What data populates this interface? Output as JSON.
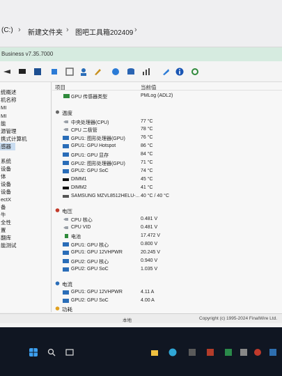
{
  "breadcrumb": {
    "drive": "(C:)",
    "folder1": "新建文件夹",
    "folder2": "图吧工具箱202409"
  },
  "app": {
    "title": "Business v7.35.7000"
  },
  "sidebar": {
    "items": [
      "统概述",
      "机名称",
      "MI",
      "MI",
      "能",
      "源管理",
      "携式计算机",
      "感器",
      "",
      "系统",
      "设备",
      "体",
      "设备",
      "设备",
      "ectX",
      "备",
      "牛",
      "全性",
      "置",
      "翻库",
      "能测试"
    ],
    "selected_index": 7
  },
  "columns": {
    "item": "项目",
    "value": "当前值"
  },
  "sensor_type": {
    "label": "GPU 传感器类型",
    "value": "PMLog (ADL2)"
  },
  "temperature": {
    "title": "温度",
    "rows": [
      {
        "label": "中央处理器(CPU)",
        "value": "77 °C"
      },
      {
        "label": "CPU 二极管",
        "value": "78 °C"
      },
      {
        "label": "GPU1: 图形处理器(GPU)",
        "value": "76 °C"
      },
      {
        "label": "GPU1: GPU Hotspot",
        "value": "86 °C"
      },
      {
        "label": "GPU1: GPU 显存",
        "value": "84 °C"
      },
      {
        "label": "GPU2: 图形处理器(GPU)",
        "value": "71 °C"
      },
      {
        "label": "GPU2: GPU SoC",
        "value": "74 °C"
      },
      {
        "label": "DIMM1",
        "value": "45 °C"
      },
      {
        "label": "DIMM2",
        "value": "41 °C"
      },
      {
        "label": "SAMSUNG MZVL8512HELU-...",
        "value": "40 °C / 40 °C"
      }
    ]
  },
  "voltage": {
    "title": "电压",
    "rows": [
      {
        "label": "CPU 核心",
        "value": "0.481 V"
      },
      {
        "label": "CPU VID",
        "value": "0.481 V"
      },
      {
        "label": "电池",
        "value": "17.472 V"
      },
      {
        "label": "GPU1: GPU 核心",
        "value": "0.800 V"
      },
      {
        "label": "GPU1: GPU 12VHPWR",
        "value": "20.245 V"
      },
      {
        "label": "GPU2: GPU 核心",
        "value": "0.940 V"
      },
      {
        "label": "GPU2: GPU SoC",
        "value": "1.035 V"
      }
    ]
  },
  "current": {
    "title": "电流",
    "rows": [
      {
        "label": "GPU1: GPU 12VHPWR",
        "value": "4.11 A"
      },
      {
        "label": "GPU2: GPU SoC",
        "value": "4.00 A"
      }
    ]
  },
  "power": {
    "title": "功耗"
  },
  "status": {
    "local": "本地",
    "copyright": "Copyright (c) 1995-2024 FinalWire Ltd."
  },
  "colors": {
    "accent": "#2b7bd6",
    "title_bar": "#d6ebe0",
    "selection": "#c9dcf0"
  }
}
